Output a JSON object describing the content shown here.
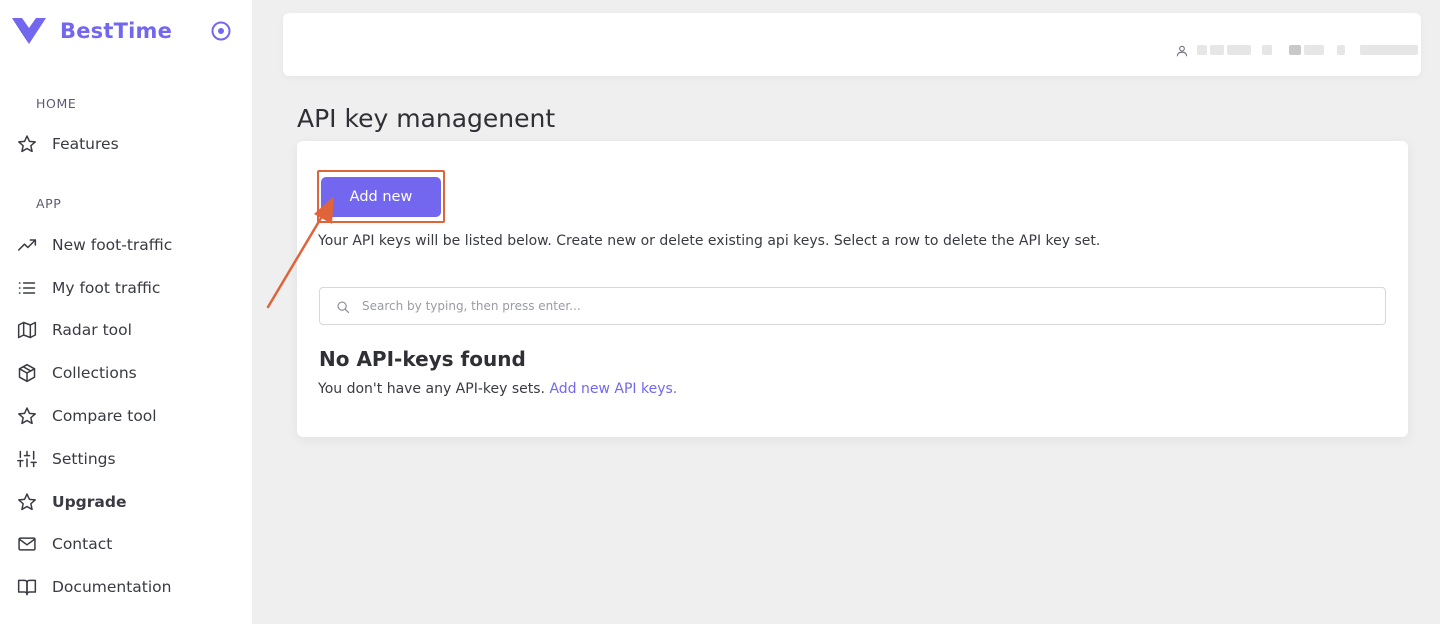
{
  "brand": {
    "name": "BestTime",
    "accent": "#7367f0"
  },
  "sidebar": {
    "sections": [
      {
        "title": "HOME",
        "items": [
          {
            "label": "Features",
            "icon": "star-icon"
          }
        ]
      },
      {
        "title": "APP",
        "items": [
          {
            "label": "New foot-traffic",
            "icon": "trending-up-icon"
          },
          {
            "label": "My foot traffic",
            "icon": "list-icon"
          },
          {
            "label": "Radar tool",
            "icon": "map-icon"
          },
          {
            "label": "Collections",
            "icon": "box-icon"
          },
          {
            "label": "Compare tool",
            "icon": "star-icon"
          },
          {
            "label": "Settings",
            "icon": "sliders-icon"
          },
          {
            "label": "Upgrade",
            "icon": "star-icon",
            "bold": true
          },
          {
            "label": "Contact",
            "icon": "mail-icon"
          },
          {
            "label": "Documentation",
            "icon": "book-icon"
          }
        ]
      }
    ]
  },
  "main": {
    "page_title": "API key managenent",
    "add_button_label": "Add new",
    "description": "Your API keys will be listed below. Create new or delete existing api keys. Select a row to delete the API key set.",
    "search": {
      "placeholder": "Search by typing, then press enter..."
    },
    "empty": {
      "title": "No API-keys found",
      "text": "You don't have any API-key sets.",
      "link": "Add new API keys."
    }
  },
  "annotation": {
    "color": "#e0643a"
  }
}
